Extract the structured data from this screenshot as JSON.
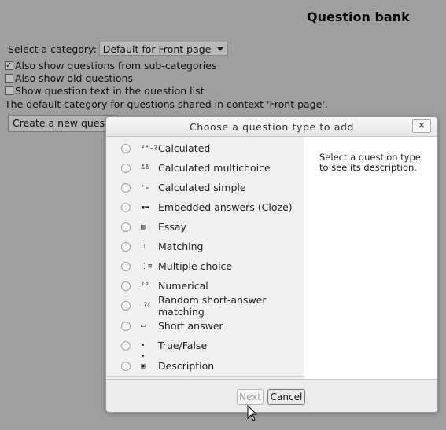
{
  "page": {
    "title": "Question bank",
    "category_label": "Select a category:",
    "category_value": "Default for Front page",
    "checkboxes": [
      {
        "label": "Also show questions from sub-categories",
        "checked": true
      },
      {
        "label": "Also show old questions",
        "checked": false
      },
      {
        "label": "Show question text in the question list",
        "checked": false
      }
    ],
    "default_note": "The default category for questions shared in context 'Front page'.",
    "create_button": "Create a new question ..."
  },
  "dialog": {
    "title": "Choose a question type to add",
    "close_glyph": "✕",
    "description_hint": "Select a question type to see its description.",
    "options": [
      {
        "label": "Calculated",
        "icon": "calculated-icon",
        "glyph": "²⁺₌?"
      },
      {
        "label": "Calculated multichoice",
        "icon": "calculated-multichoice-icon",
        "glyph": "≛≚"
      },
      {
        "label": "Calculated simple",
        "icon": "calculated-simple-icon",
        "glyph": "⁺₌"
      },
      {
        "label": "Embedded answers (Cloze)",
        "icon": "cloze-icon",
        "glyph": "▪▬"
      },
      {
        "label": "Essay",
        "icon": "essay-icon",
        "glyph": "▤"
      },
      {
        "label": "Matching",
        "icon": "matching-icon",
        "glyph": "⁝⁝"
      },
      {
        "label": "Multiple choice",
        "icon": "multiple-choice-icon",
        "glyph": "⋮≡"
      },
      {
        "label": "Numerical",
        "icon": "numerical-icon",
        "glyph": "¹²"
      },
      {
        "label": "Random short-answer matching",
        "icon": "random-matching-icon",
        "glyph": "⁝?⁝"
      },
      {
        "label": "Short answer",
        "icon": "short-answer-icon",
        "glyph": "▭"
      },
      {
        "label": "True/False",
        "icon": "true-false-icon",
        "glyph": "• •"
      },
      {
        "label": "Description",
        "icon": "description-icon",
        "glyph": "▣"
      }
    ],
    "next_label": "Next",
    "cancel_label": "Cancel"
  }
}
